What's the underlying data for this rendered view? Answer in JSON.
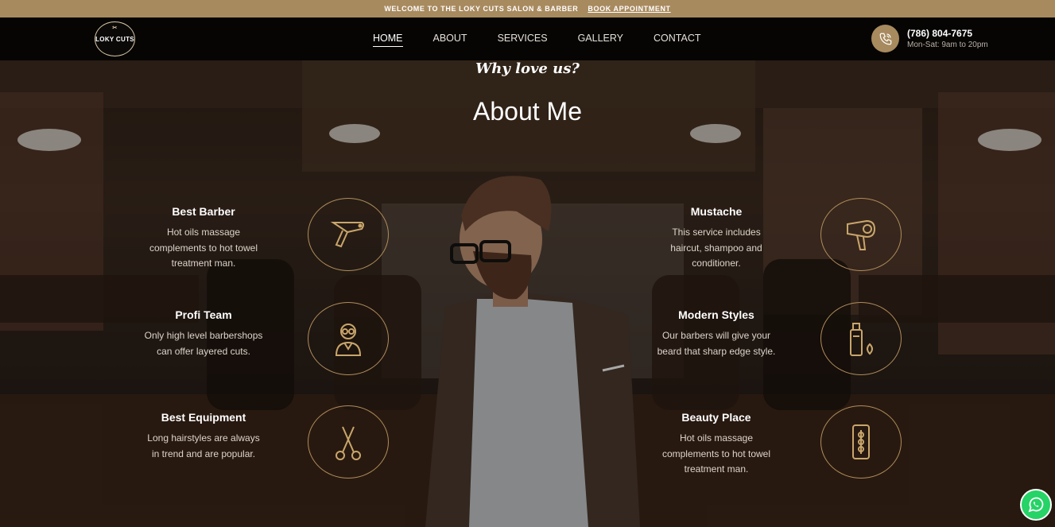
{
  "topbar": {
    "welcome": "WELCOME TO THE LOKY CUTS SALON & BARBER",
    "book": "BOOK APPOINTMENT"
  },
  "header": {
    "logo_text": "LOKY CUTS",
    "nav": [
      "HOME",
      "ABOUT",
      "SERVICES",
      "GALLERY",
      "CONTACT"
    ],
    "active_nav": "HOME",
    "phone": "(786) 804-7675",
    "hours": "Mon-Sat: 9am to 20pm"
  },
  "section": {
    "kicker": "Why love us?",
    "title": "About Me"
  },
  "features_left": [
    {
      "title": "Best Barber",
      "text": "Hot oils massage complements to hot towel treatment man.",
      "icon": "razor-icon"
    },
    {
      "title": "Profi Team",
      "text": "Only high level barbershops can offer layered cuts.",
      "icon": "barber-person-icon"
    },
    {
      "title": "Best Equipment",
      "text": "Long hairstyles are always in trend and are popular.",
      "icon": "scissors-icon"
    }
  ],
  "features_right": [
    {
      "title": "Mustache",
      "text": "This service includes haircut, shampoo and conditioner.",
      "icon": "hair-dryer-icon"
    },
    {
      "title": "Modern Styles",
      "text": "Our barbers will give your beard that sharp edge style.",
      "icon": "spray-bottle-icon"
    },
    {
      "title": "Beauty Place",
      "text": "Hot oils massage complements to hot towel treatment man.",
      "icon": "razor-blade-icon"
    }
  ],
  "colors": {
    "accent": "#a88a5f",
    "header_bg": "#060504",
    "whatsapp": "#25d366"
  }
}
